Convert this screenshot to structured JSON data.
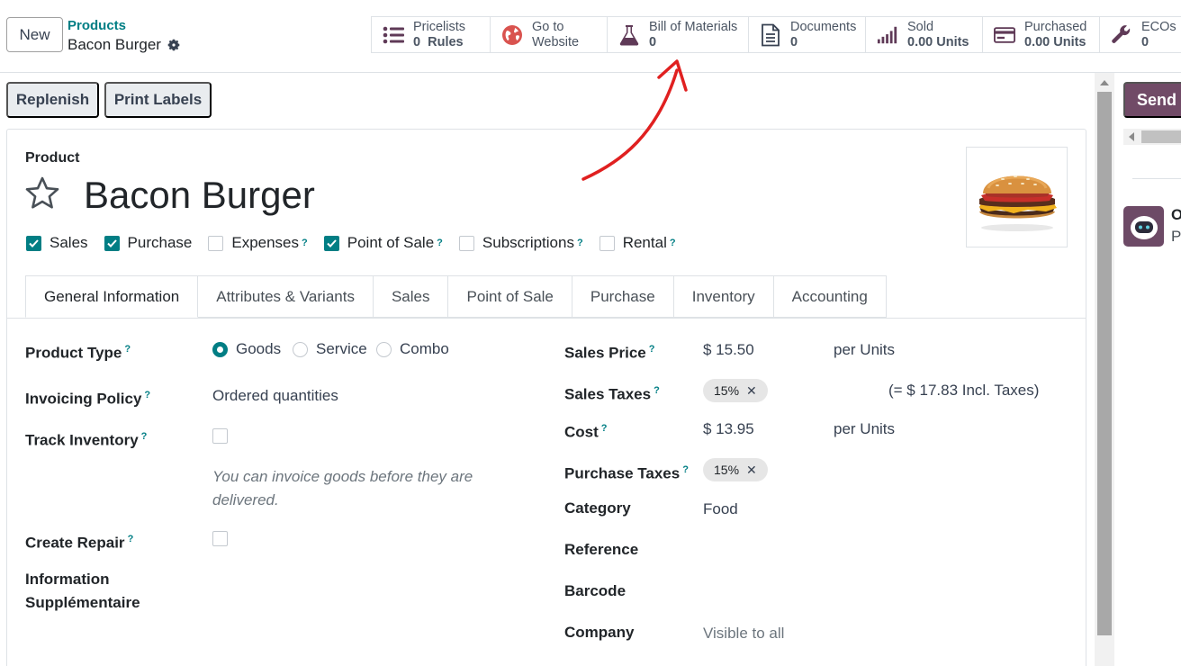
{
  "header": {
    "new_label": "New",
    "breadcrumb": "Products",
    "record_name": "Bacon Burger"
  },
  "smart_buttons": [
    {
      "label": "Pricelists",
      "value": "0  Rules",
      "icon": "list-icon"
    },
    {
      "label": "Go to",
      "value": "Website",
      "icon": "globe-icon"
    },
    {
      "label": "Bill of Materials",
      "value": "0",
      "icon": "flask-icon"
    },
    {
      "label": "Documents",
      "value": "0",
      "icon": "document-icon"
    },
    {
      "label": "Sold",
      "value": "0.00 Units",
      "icon": "signal-bars-icon"
    },
    {
      "label": "Purchased",
      "value": "0.00 Units",
      "icon": "credit-card-icon"
    },
    {
      "label": "ECOs",
      "value": "0",
      "icon": "wrench-icon"
    }
  ],
  "actions": {
    "replenish": "Replenish",
    "print_labels": "Print Labels"
  },
  "product": {
    "label": "Product",
    "name": "Bacon Burger"
  },
  "options": [
    {
      "label": "Sales",
      "checked": true,
      "help": false
    },
    {
      "label": "Purchase",
      "checked": true,
      "help": false
    },
    {
      "label": "Expenses",
      "checked": false,
      "help": true
    },
    {
      "label": "Point of Sale",
      "checked": true,
      "help": true
    },
    {
      "label": "Subscriptions",
      "checked": false,
      "help": true
    },
    {
      "label": "Rental",
      "checked": false,
      "help": true
    }
  ],
  "tabs": [
    "General Information",
    "Attributes & Variants",
    "Sales",
    "Point of Sale",
    "Purchase",
    "Inventory",
    "Accounting"
  ],
  "help_mark": "?",
  "left_fields": {
    "product_type": "Product Type",
    "product_type_options": [
      "Goods",
      "Service",
      "Combo"
    ],
    "invoicing_policy": "Invoicing Policy",
    "invoicing_policy_value": "Ordered quantities",
    "track_inventory": "Track Inventory",
    "invoice_note": "You can invoice goods before they are delivered.",
    "create_repair": "Create Repair",
    "info_line1": "Information",
    "info_line2": "Supplémentaire"
  },
  "right_fields": {
    "sales_price": "Sales Price",
    "sales_price_value": "$ 15.50",
    "sales_price_unit": "per Units",
    "sales_taxes": "Sales Taxes",
    "sales_taxes_tag": "15%",
    "incl_taxes": "(= $ 17.83 Incl. Taxes)",
    "cost": "Cost",
    "cost_value": "$ 13.95",
    "cost_unit": "per Units",
    "purchase_taxes": "Purchase Taxes",
    "purchase_taxes_tag": "15%",
    "category": "Category",
    "category_value": "Food",
    "reference": "Reference",
    "barcode": "Barcode",
    "company": "Company",
    "company_value": "Visible to all"
  },
  "chatter": {
    "send_label": "Send message",
    "author_initial": "O",
    "message_initial": "P"
  },
  "colors": {
    "accent": "#017e84",
    "brand": "#714b67",
    "annotation": "#e02020"
  }
}
